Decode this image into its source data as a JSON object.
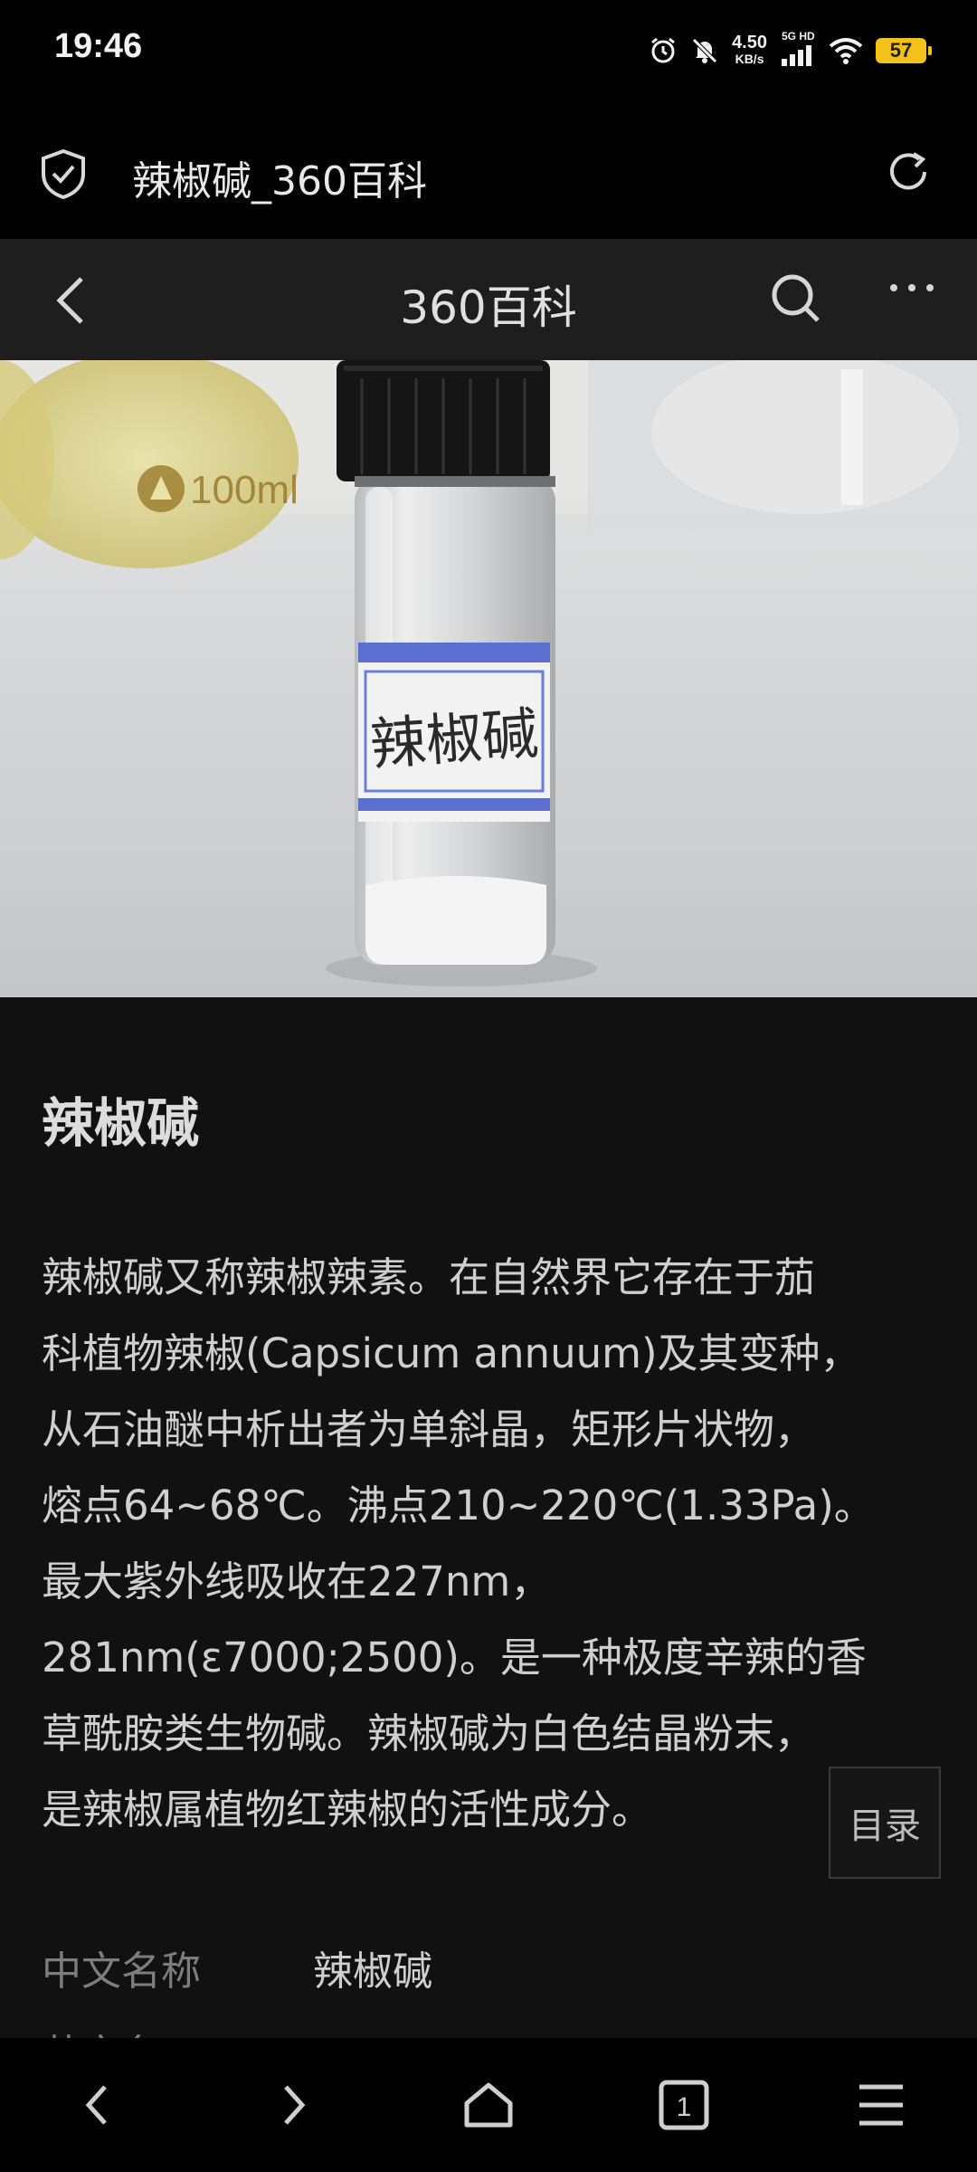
{
  "status_bar": {
    "time": "19:46",
    "net_speed_value": "4.50",
    "net_speed_unit": "KB/s",
    "signal_label": "5G HD",
    "battery": "57",
    "icons": [
      "alarm-icon",
      "mute-icon",
      "signal-icon",
      "wifi-icon",
      "battery-icon"
    ]
  },
  "address_bar": {
    "page_title": "辣椒碱_360百科",
    "icons": [
      "shield-icon",
      "reload-icon"
    ]
  },
  "site_header": {
    "title": "360百科",
    "icons": [
      "back-icon",
      "search-icon",
      "more-icon"
    ]
  },
  "hero": {
    "vial_label": "辣椒碱",
    "flask_label": "100ml"
  },
  "article": {
    "title": "辣椒碱",
    "body": "辣椒碱又称辣椒辣素。在自然界它存在于茄\n科植物辣椒(Capsicum annuum)及其变种，\n从石油醚中析出者为单斜晶，矩形片状物，\n熔点64~68℃。沸点210~220℃(1.33Pa)。\n最大紫外线吸收在227nm，\n281nm(ε7000;2500)。是一种极度辛辣的香\n草酰胺类生物碱。辣椒碱为白色结晶粉末，\n是辣椒属植物红辣椒的活性成分。",
    "toc_button": "目录",
    "info": {
      "label_1": "中文名称",
      "value_1": "辣椒碱",
      "label_2": "英文名"
    }
  },
  "bottom_nav": {
    "tab_count": "1",
    "icons": [
      "nav-back-icon",
      "nav-forward-icon",
      "home-icon",
      "tabs-icon",
      "menu-icon"
    ]
  }
}
